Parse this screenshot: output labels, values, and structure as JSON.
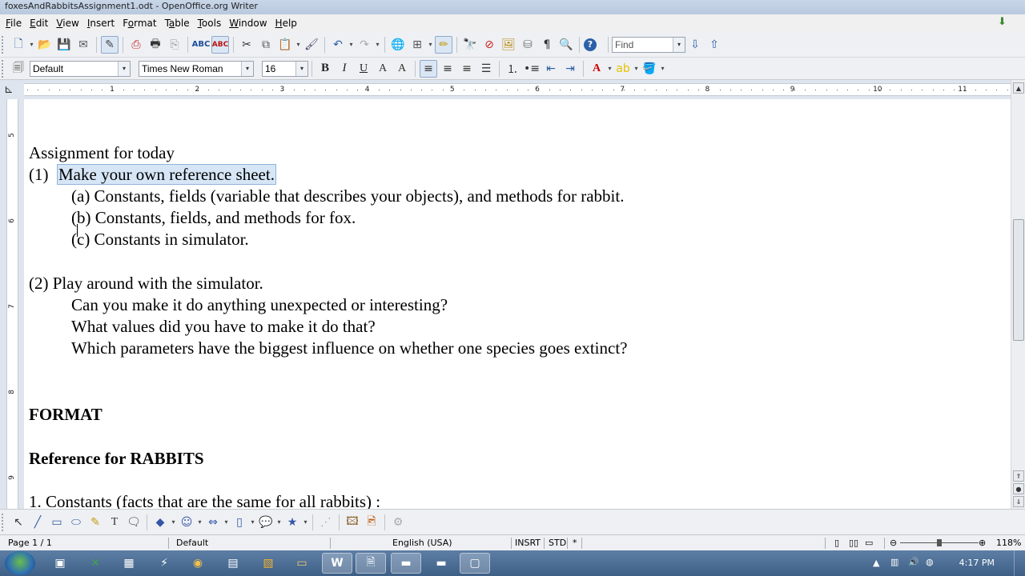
{
  "window": {
    "title": "foxesAndRabbitsAssignment1.odt - OpenOffice.org Writer"
  },
  "menu": [
    {
      "pre": "",
      "key": "F",
      "post": "ile"
    },
    {
      "pre": "",
      "key": "E",
      "post": "dit"
    },
    {
      "pre": "",
      "key": "V",
      "post": "iew"
    },
    {
      "pre": "",
      "key": "I",
      "post": "nsert"
    },
    {
      "pre": "F",
      "key": "o",
      "post": "rmat"
    },
    {
      "pre": "T",
      "key": "a",
      "post": "ble"
    },
    {
      "pre": "",
      "key": "T",
      "post": "ools"
    },
    {
      "pre": "",
      "key": "W",
      "post": "indow"
    },
    {
      "pre": "",
      "key": "H",
      "post": "elp"
    }
  ],
  "toolbar": {
    "find_placeholder": "Find"
  },
  "formatting": {
    "paragraph_style": "Default",
    "font_name": "Times New Roman",
    "font_size": "16"
  },
  "ruler": {
    "numbers": [
      "1",
      "2",
      "3",
      "4",
      "5",
      "6",
      "7",
      "8",
      "9",
      "10",
      "11"
    ]
  },
  "vruler": {
    "numbers": [
      "5",
      "6",
      "7",
      "8",
      "9"
    ]
  },
  "document": {
    "heading": "Assignment for today",
    "item1_number": "(1)",
    "item1_text": "Make your own reference sheet.",
    "item1_a": "(a)  Constants, fields (variable that describes your objects), and methods for rabbit.",
    "item1_b": "(b)  Constants, fields, and methods for fox.",
    "item1_c": "(c)  Constants in simulator.",
    "item2": "(2)  Play around with the simulator.",
    "item2_q1": "Can you make it do anything unexpected or interesting?",
    "item2_q2": "What values did you have to make it do that?",
    "item2_q3": "Which parameters have the biggest influence on whether one species goes extinct?",
    "format_heading": "FORMAT",
    "reference_heading": "Reference for RABBITS",
    "constants_line": "1.  Constants (facts that are the same for all rabbits) :"
  },
  "status": {
    "page": "Page 1 / 1",
    "style": "Default",
    "language": "English (USA)",
    "insert_mode": "INSRT",
    "selection_mode": "STD",
    "modified": "*",
    "zoom": "118%",
    "zoom_level_percent": 118
  },
  "taskbar": {
    "clock": "4:17 PM"
  },
  "colors": {
    "selection": "#d6e6f7",
    "accent": "#2c5fa8"
  }
}
